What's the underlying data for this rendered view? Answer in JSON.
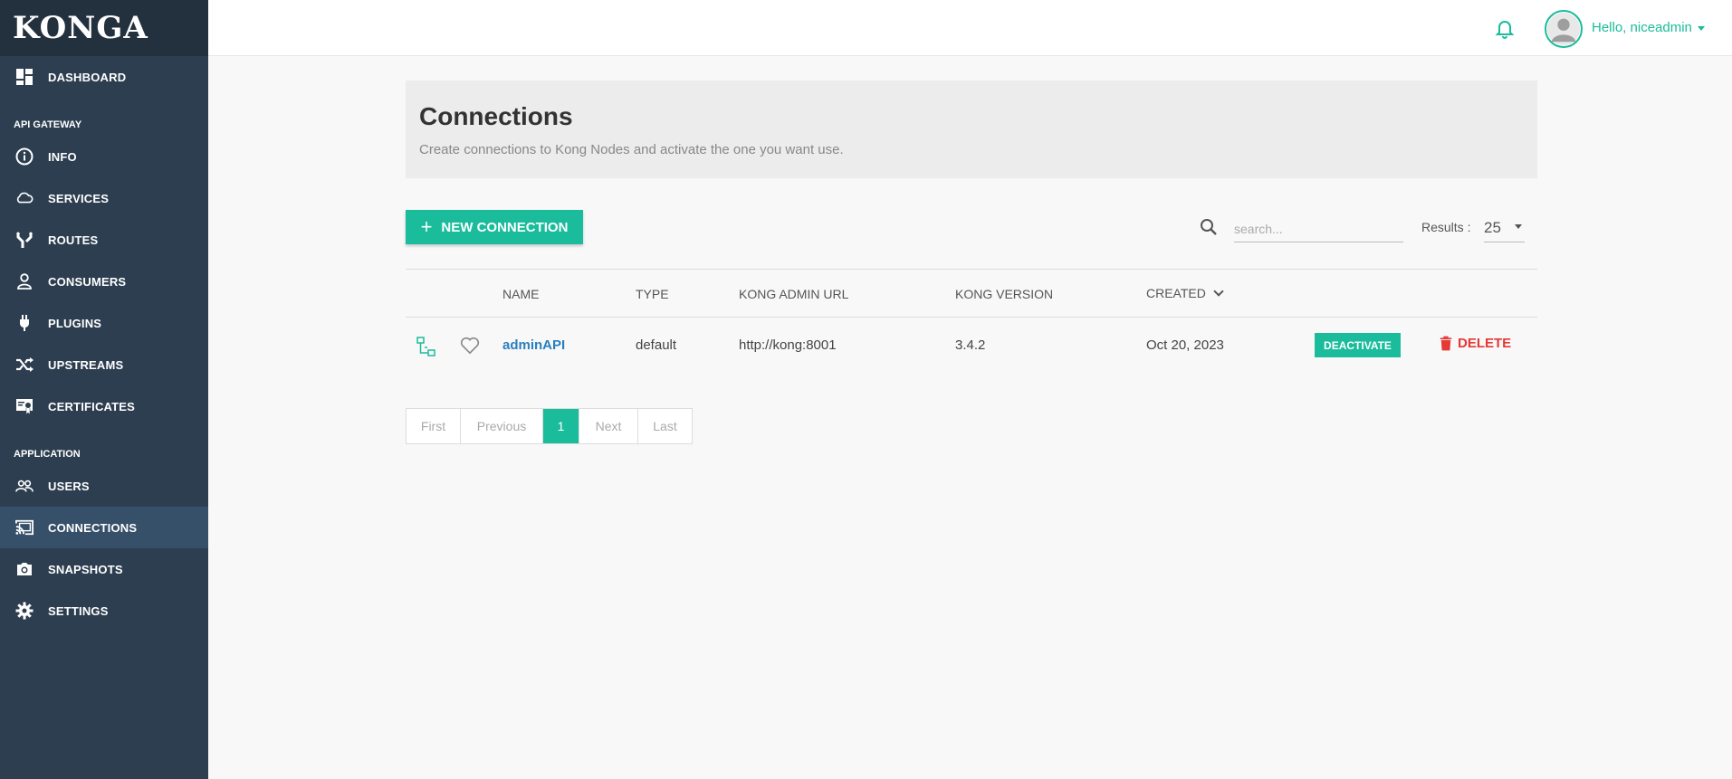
{
  "app": {
    "logo": "KONGA"
  },
  "sidebar": {
    "dashboard": {
      "label": "DASHBOARD",
      "icon": "dashboard-icon"
    },
    "sections": [
      {
        "title": "API GATEWAY",
        "items": [
          {
            "label": "INFO",
            "icon": "info-icon"
          },
          {
            "label": "SERVICES",
            "icon": "cloud-icon"
          },
          {
            "label": "ROUTES",
            "icon": "routes-icon"
          },
          {
            "label": "CONSUMERS",
            "icon": "user-icon"
          },
          {
            "label": "PLUGINS",
            "icon": "plug-icon"
          },
          {
            "label": "UPSTREAMS",
            "icon": "shuffle-icon"
          },
          {
            "label": "CERTIFICATES",
            "icon": "certificate-icon"
          }
        ]
      },
      {
        "title": "APPLICATION",
        "items": [
          {
            "label": "USERS",
            "icon": "users-icon"
          },
          {
            "label": "CONNECTIONS",
            "icon": "cast-icon",
            "active": true
          },
          {
            "label": "SNAPSHOTS",
            "icon": "camera-icon"
          },
          {
            "label": "SETTINGS",
            "icon": "gear-icon"
          }
        ]
      }
    ]
  },
  "topbar": {
    "greeting": "Hello, niceadmin",
    "accent_color": "#1abc9c"
  },
  "page": {
    "title": "Connections",
    "subtitle": "Create connections to Kong Nodes and activate the one you want use."
  },
  "toolbar": {
    "new_connection_label": "NEW CONNECTION",
    "search_placeholder": "search...",
    "results_label": "Results :",
    "results_value": "25"
  },
  "table": {
    "columns": {
      "name": "NAME",
      "type": "TYPE",
      "kong_admin_url": "KONG ADMIN URL",
      "kong_version": "KONG VERSION",
      "created": "CREATED"
    },
    "rows": [
      {
        "name": "adminAPI",
        "type": "default",
        "kong_admin_url": "http://kong:8001",
        "kong_version": "3.4.2",
        "created": "Oct 20, 2023",
        "deactivate_label": "DEACTIVATE",
        "delete_label": "DELETE"
      }
    ]
  },
  "pagination": {
    "first": "First",
    "previous": "Previous",
    "current": "1",
    "next": "Next",
    "last": "Last"
  },
  "colors": {
    "sidebar_bg": "#2d3e50",
    "accent": "#1abc9c",
    "danger": "#e53935",
    "link": "#2a7fc1"
  }
}
